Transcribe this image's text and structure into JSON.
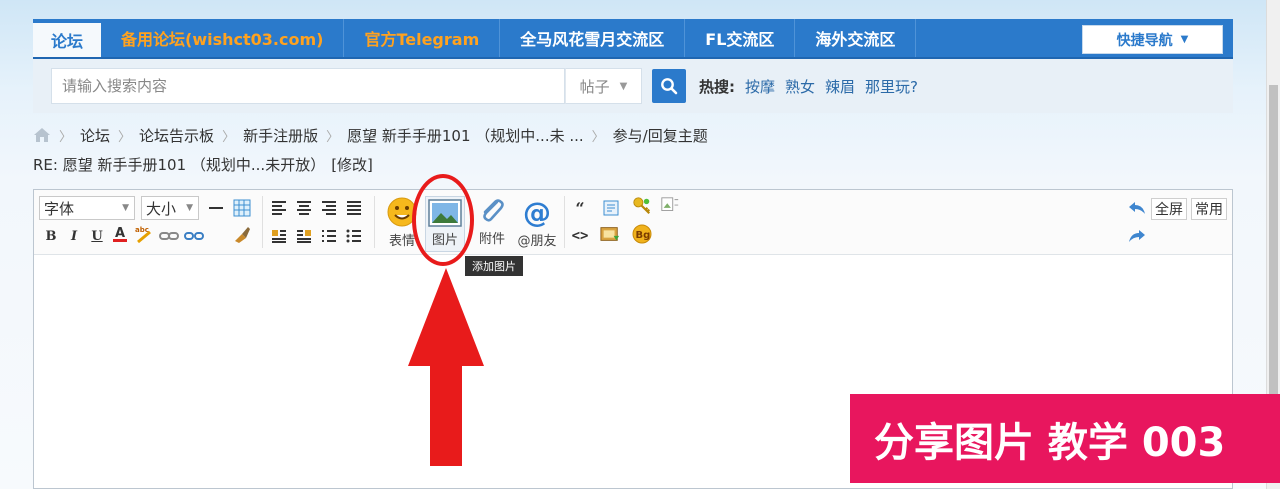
{
  "nav": {
    "items": [
      {
        "label": "论坛",
        "active": true
      },
      {
        "label": "备用论坛(wishct03.com)",
        "color": "orange"
      },
      {
        "label": "官方Telegram",
        "color": "orange"
      },
      {
        "label": "全马风花雪月交流区"
      },
      {
        "label": "FL交流区"
      },
      {
        "label": "海外交流区"
      }
    ],
    "quick_nav": "快捷导航"
  },
  "search": {
    "placeholder": "请输入搜索内容",
    "type_selected": "帖子",
    "hot_label": "热搜:",
    "hot_terms": [
      "按摩",
      "熟女",
      "辣眉",
      "那里玩?"
    ]
  },
  "breadcrumb": [
    "论坛",
    "论坛告示板",
    "新手注册版",
    "愿望 新手手册101 （规划中...未 ...",
    "参与/回复主题"
  ],
  "reply_title": {
    "text": "RE: 愿望 新手手册101 （规划中...未开放）",
    "edit_link": "[修改]"
  },
  "toolbar": {
    "font_select": "字体",
    "size_select": "大小",
    "emoji_label": "表情",
    "image_label": "图片",
    "attach_label": "附件",
    "mention_label": "@朋友",
    "fullscreen_label": "全屏",
    "common_label": "常用",
    "tooltip": "添加图片"
  },
  "banner": {
    "text": "分享图片 教学 003"
  },
  "colors": {
    "nav_blue": "#2b7acb",
    "nav_orange": "#ffa21f",
    "annotation_red": "#e81b1b",
    "banner_pink": "#e8165e"
  }
}
